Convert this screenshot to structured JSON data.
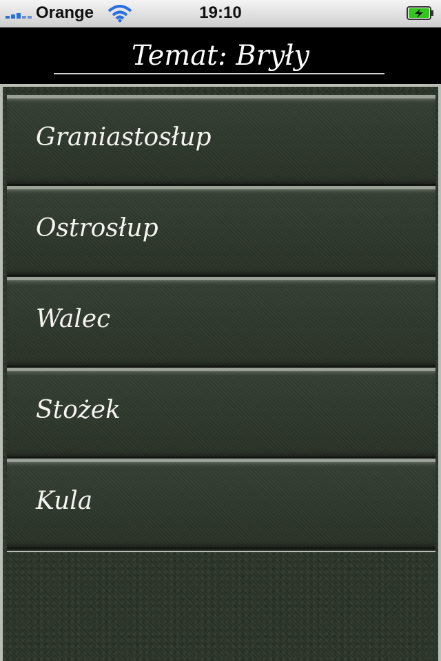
{
  "status_bar": {
    "carrier": "Orange",
    "time": "19:10",
    "icons": [
      "signal-icon",
      "wifi-icon",
      "battery-charging-icon"
    ]
  },
  "header": {
    "title": "Temat: Bryły"
  },
  "menu": {
    "items": [
      {
        "label": "Graniastosłup"
      },
      {
        "label": "Ostrosłup"
      },
      {
        "label": "Walec"
      },
      {
        "label": "Stożek"
      },
      {
        "label": "Kula"
      }
    ]
  },
  "colors": {
    "background": "#2b3429",
    "header_bg": "#000000",
    "text": "#f4f4f0",
    "signal": "#2a6fe0",
    "battery": "#34c51e"
  }
}
